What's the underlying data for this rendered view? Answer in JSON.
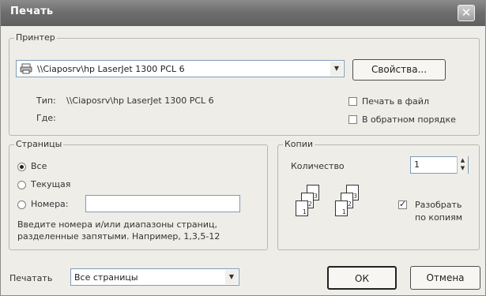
{
  "window": {
    "title": "Печать"
  },
  "printer": {
    "legend": "Принтер",
    "name_value": "\\\\Ciaposrv\\hp LaserJet 1300 PCL 6",
    "properties_label": "Свойства...",
    "type_label": "Тип:",
    "type_value": "\\\\Ciaposrv\\hp LaserJet 1300 PCL 6",
    "where_label": "Где:",
    "print_to_file_label": "Печать в файл",
    "reverse_order_label": "В обратном порядке"
  },
  "pages": {
    "legend": "Страницы",
    "all_label": "Все",
    "current_label": "Текущая",
    "numbers_label": "Номера:",
    "numbers_value": "",
    "hint": "Введите номера и/или диапазоны страниц, разделенные запятыми. Например, 1,3,5-12"
  },
  "copies": {
    "legend": "Копии",
    "count_label": "Количество",
    "count_value": "1",
    "collate_label_line1": "Разобрать",
    "collate_label_line2": "по копиям",
    "page_numbers": [
      "1",
      "2",
      "3"
    ]
  },
  "bottom": {
    "print_label": "Печатать",
    "print_value": "Все страницы",
    "ok_label": "ОК",
    "cancel_label": "Отмена"
  },
  "icons": {
    "printer": "printer-icon",
    "close": "close-icon",
    "dropdown": "chevron-down-icon",
    "spin": "spinner-arrows-icon"
  }
}
